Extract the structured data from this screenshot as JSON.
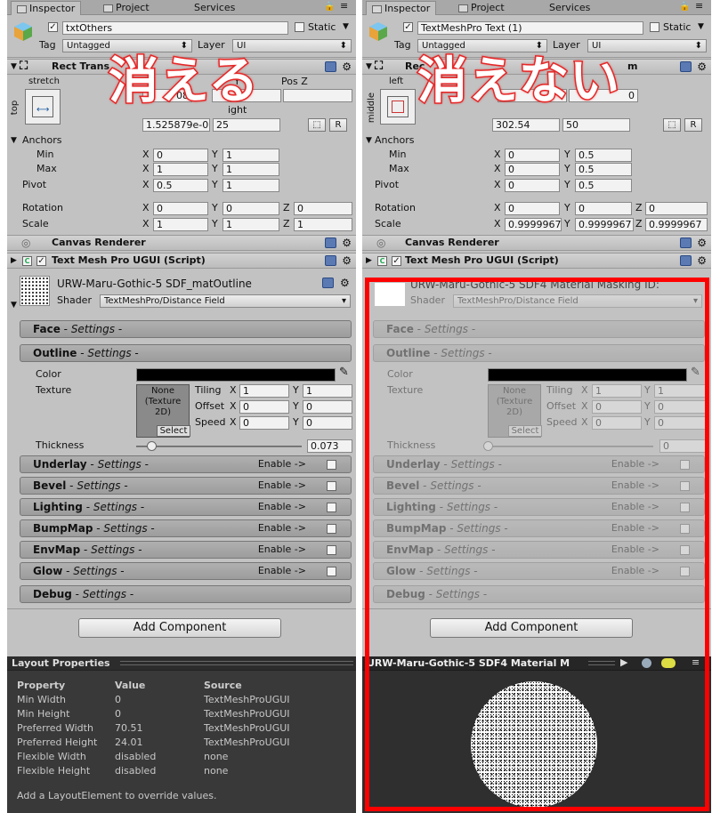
{
  "left": {
    "tabs": [
      "Inspector",
      "Project",
      "Services"
    ],
    "name": "txtOthers",
    "static_label": "Static",
    "tag_label": "Tag",
    "tag": "Untagged",
    "layer_label": "Layer",
    "layer": "UI",
    "rect_title": "Rect Trans",
    "anchor_preset": "stretch",
    "side_preset": "top",
    "fragments": {
      "a": "08",
      "b": "Y",
      "c": "Pos Z",
      "d": "ight"
    },
    "row1": [
      "1.525879e-0",
      "25"
    ],
    "anchors_label": "Anchors",
    "min_label": "Min",
    "max_label": "Max",
    "pivot_label": "Pivot",
    "rotation_label": "Rotation",
    "scale_label": "Scale",
    "min": [
      "0",
      "1"
    ],
    "max": [
      "1",
      "1"
    ],
    "pivot": [
      "0.5",
      "1"
    ],
    "rotation": [
      "0",
      "0",
      "0"
    ],
    "scale": [
      "1",
      "1",
      "1"
    ],
    "canvas_renderer": "Canvas Renderer",
    "tmp_script": "Text Mesh Pro UGUI (Script)",
    "material": "URW-Maru-Gothic-5 SDF_matOutline",
    "shader_label": "Shader",
    "shader": "TextMeshPro/Distance Field",
    "sections": [
      {
        "name": "Face",
        "sub": "Settings"
      },
      {
        "name": "Outline",
        "sub": "Settings"
      }
    ],
    "color_label": "Color",
    "texture_label": "Texture",
    "tex_none": "None (Texture 2D)",
    "tex_select": "Select",
    "tiling_label": "Tiling",
    "offset_label": "Offset",
    "speed_label": "Speed",
    "tiling": [
      "1",
      "1"
    ],
    "offset": [
      "0",
      "0"
    ],
    "speed": [
      "0",
      "0"
    ],
    "thickness_label": "Thickness",
    "thickness": "0.073",
    "thickness_level": 0.09,
    "enable_sections": [
      {
        "name": "Underlay",
        "sub": "Settings"
      },
      {
        "name": "Bevel",
        "sub": "Settings"
      },
      {
        "name": "Lighting",
        "sub": "Settings"
      },
      {
        "name": "BumpMap",
        "sub": "Settings"
      },
      {
        "name": "EnvMap",
        "sub": "Settings"
      },
      {
        "name": "Glow",
        "sub": "Settings"
      }
    ],
    "enable_label": "Enable ->",
    "debug": {
      "name": "Debug",
      "sub": "Settings"
    },
    "add_component": "Add Component",
    "layout_title": "Layout Properties",
    "layout_headers": [
      "Property",
      "Value",
      "Source"
    ],
    "layout_rows": [
      [
        "Min Width",
        "0",
        "TextMeshProUGUI"
      ],
      [
        "Min Height",
        "0",
        "TextMeshProUGUI"
      ],
      [
        "Preferred Width",
        "70.51",
        "TextMeshProUGUI"
      ],
      [
        "Preferred Height",
        "24.01",
        "TextMeshProUGUI"
      ],
      [
        "Flexible Width",
        "disabled",
        "none"
      ],
      [
        "Flexible Height",
        "disabled",
        "none"
      ]
    ],
    "layout_note": "Add a LayoutElement to override values.",
    "overlay": "消える"
  },
  "right": {
    "tabs": [
      "Inspector",
      "Project",
      "Services"
    ],
    "name": "TextMeshPro Text (1)",
    "static_label": "Static",
    "tag_label": "Tag",
    "tag": "Untagged",
    "layer_label": "Layer",
    "layer": "UI",
    "rect_title": "Rec",
    "anchor_preset": "left",
    "side_preset": "middle",
    "fragments": {
      "a": "0",
      "b": "m"
    },
    "row1": [
      "302.54",
      "50"
    ],
    "anchors_label": "Anchors",
    "min_label": "Min",
    "max_label": "Max",
    "pivot_label": "Pivot",
    "rotation_label": "Rotation",
    "scale_label": "Scale",
    "min": [
      "0",
      "0.5"
    ],
    "max": [
      "0",
      "0.5"
    ],
    "pivot": [
      "0",
      "0.5"
    ],
    "rotation": [
      "0",
      "0",
      "0"
    ],
    "scale": [
      "0.9999967",
      "0.9999967",
      "0.9999967"
    ],
    "canvas_renderer": "Canvas Renderer",
    "tmp_script": "Text Mesh Pro UGUI (Script)",
    "material": "URW-Maru-Gothic-5 SDF4 Material Masking ID:",
    "shader_label": "Shader",
    "shader": "TextMeshPro/Distance Field",
    "sections": [
      {
        "name": "Face",
        "sub": "Settings"
      },
      {
        "name": "Outline",
        "sub": "Settings"
      }
    ],
    "color_label": "Color",
    "texture_label": "Texture",
    "tex_none": "None (Texture 2D)",
    "tex_select": "Select",
    "tiling_label": "Tiling",
    "offset_label": "Offset",
    "speed_label": "Speed",
    "tiling": [
      "1",
      "1"
    ],
    "offset": [
      "0",
      "0"
    ],
    "speed": [
      "0",
      "0"
    ],
    "thickness_label": "Thickness",
    "thickness": "0",
    "thickness_level": 0,
    "enable_sections": [
      {
        "name": "Underlay",
        "sub": "Settings"
      },
      {
        "name": "Bevel",
        "sub": "Settings"
      },
      {
        "name": "Lighting",
        "sub": "Settings"
      },
      {
        "name": "BumpMap",
        "sub": "Settings"
      },
      {
        "name": "EnvMap",
        "sub": "Settings"
      },
      {
        "name": "Glow",
        "sub": "Settings"
      }
    ],
    "enable_label": "Enable ->",
    "debug": {
      "name": "Debug",
      "sub": "Settings"
    },
    "add_component": "Add Component",
    "preview_title": "URW-Maru-Gothic-5 SDF4 Material M",
    "overlay": "消えない"
  },
  "colors": {
    "highlight": "#f00",
    "overlay_stroke": "#e62828",
    "dark_panel": "#393939"
  },
  "icons": [
    "book-icon",
    "gear-icon",
    "eyedropper-icon",
    "play-icon",
    "lock-icon",
    "menu-icon"
  ]
}
